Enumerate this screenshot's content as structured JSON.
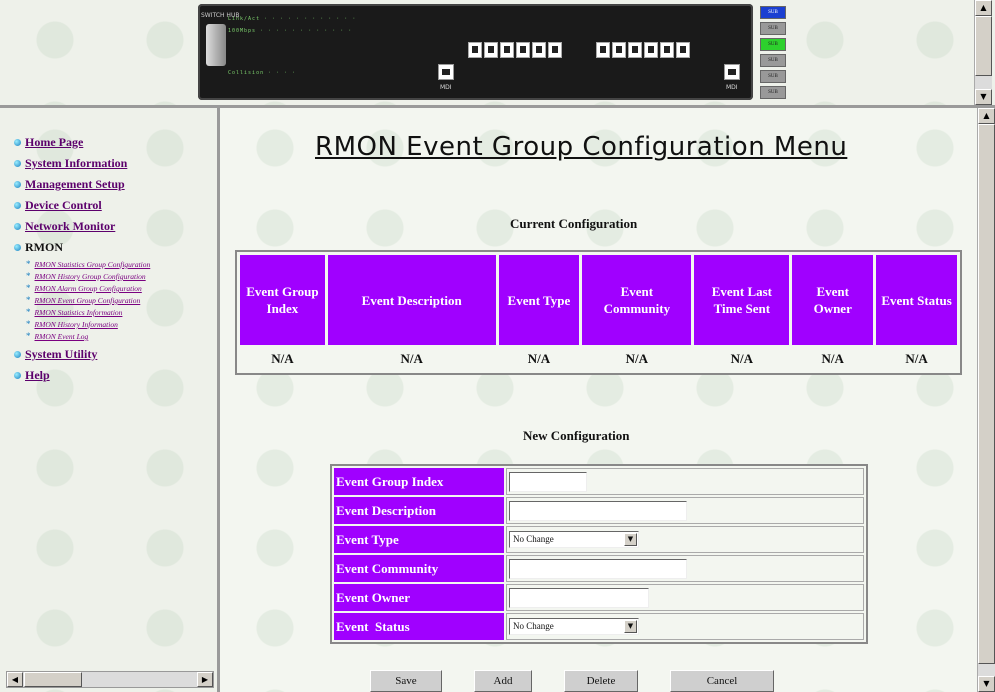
{
  "switch_panel": {
    "brand_text": "SWITCH HUB",
    "led_text_1": "Link/Act · · · · · · · · · · · ·",
    "led_text_2": "100Mbps · · · · · · · · · · · ·",
    "led_text_3": "Collision · · · ·",
    "mdi_label_left": "MDI",
    "mdi_label_right": "MDI",
    "side_buttons": [
      "SUB",
      "SUB",
      "SUB",
      "SUB",
      "SUB",
      "SUB"
    ]
  },
  "nav": {
    "items": [
      {
        "label": "Home Page",
        "link": true
      },
      {
        "label": "System Information",
        "link": true
      },
      {
        "label": "Management Setup",
        "link": true
      },
      {
        "label": "Device Control",
        "link": true
      },
      {
        "label": "Network Monitor",
        "link": true
      },
      {
        "label": "RMON",
        "link": false
      }
    ],
    "sub_items": [
      "RMON Statistics Group Configuration",
      "RMON History Group Configuration",
      "RMON Alarm Group Configuration",
      "RMON Event Group Configuration",
      "RMON Statistics Information",
      "RMON History Information",
      "RMON Event Log"
    ],
    "bottom_items": [
      {
        "label": "System Utility"
      },
      {
        "label": "Help"
      }
    ]
  },
  "main": {
    "title": "RMON Event Group Configuration Menu",
    "current_heading": "Current Configuration",
    "current_columns": [
      "Event Group Index",
      "Event Description",
      "Event Type",
      "Event Community",
      "Event Last Time Sent",
      "Event Owner",
      "Event Status"
    ],
    "current_values": [
      "N/A",
      "N/A",
      "N/A",
      "N/A",
      "N/A",
      "N/A",
      "N/A"
    ],
    "new_heading": "New Configuration",
    "new_fields": {
      "group_index_label": "Event Group Index",
      "group_index_value": "",
      "description_label": "Event Description",
      "description_value": "",
      "type_label": "Event Type",
      "type_value": "No Change",
      "community_label": "Event Community",
      "community_value": "",
      "owner_label": "Event Owner",
      "owner_value": "",
      "status_label": "Event  Status",
      "status_value": "No Change"
    },
    "buttons": {
      "save": "Save",
      "add": "Add",
      "delete": "Delete",
      "cancel": "Cancel"
    }
  },
  "colors": {
    "header_purple": "#a000ff",
    "link_purple": "#5c006c"
  }
}
